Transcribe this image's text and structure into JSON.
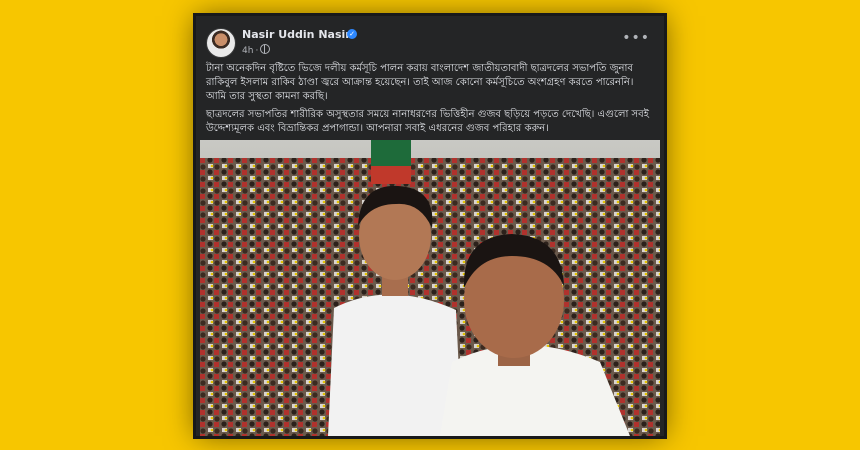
{
  "post": {
    "author": "Nasir Uddin Nasir",
    "time": "4h",
    "verified_icon": "verified-badge-icon",
    "privacy_icon": "globe-icon",
    "more_icon": "more-horizontal-icon",
    "paragraphs": [
      "টানা অনেকদিন বৃষ্টিতে ভিজে দলীয় কর্মসূচি পালন করায় বাংলাদেশ জাতীয়তাবাদী ছাত্রদলের সভাপতি জুনাব রাকিবুল ইসলাম রাকিব ঠাণ্ডা জ্বরে আক্রান্ত হয়েছেন। তাই আজ কোনো কর্মসূচিতে অংশগ্রহণ করতে পারেননি। আমি তার সুস্থতা কামনা করছি।",
      "ছাত্রদলের সভাপতির শারীরিক অসুস্থতার সময়ে নানাধরণের ভিত্তিহীন গুজব ছড়িয়ে পড়তে দেখেছি। এগুলো সবই উদ্দেশ্যমূলক এবং বিভ্রান্তিকর প্রপাগান্ডা। আপনারা সবাই এধরনের গুজব পরিহার করুন।"
    ]
  },
  "colors": {
    "background": "#f7c600",
    "card": "#242526",
    "text": "#e4e6eb",
    "muted": "#b0b3b8",
    "verified": "#2d88ff"
  }
}
